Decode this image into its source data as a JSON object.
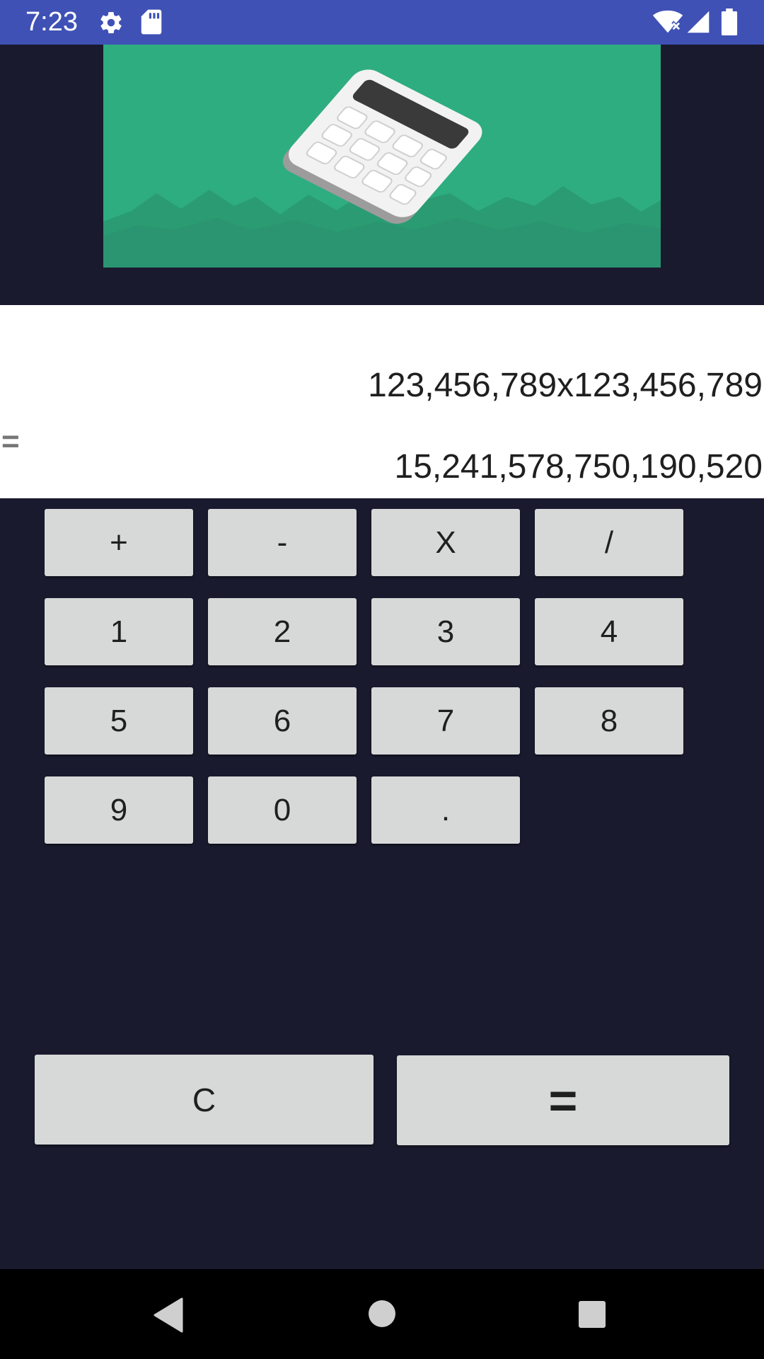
{
  "status_bar": {
    "time": "7:23",
    "icons": [
      "settings-icon",
      "sd-card-icon",
      "wifi-icon",
      "signal-icon",
      "battery-icon"
    ],
    "background_color": "#3f51b5"
  },
  "banner": {
    "icon": "calculator-illustration",
    "background_color": "#2ead80"
  },
  "display": {
    "expression": "123,456,789x123,456,789",
    "equals_sign": "=",
    "result": "15,241,578,750,190,520"
  },
  "keypad": {
    "operators": [
      "+",
      "-",
      "X",
      "/"
    ],
    "digits_row1": [
      "1",
      "2",
      "3",
      "4"
    ],
    "digits_row2": [
      "5",
      "6",
      "7",
      "8"
    ],
    "digits_row3": [
      "9",
      "0",
      "."
    ],
    "clear_label": "C",
    "equals_label": "="
  },
  "nav_bar": {
    "icons": [
      "back-icon",
      "home-icon",
      "recents-icon"
    ]
  }
}
